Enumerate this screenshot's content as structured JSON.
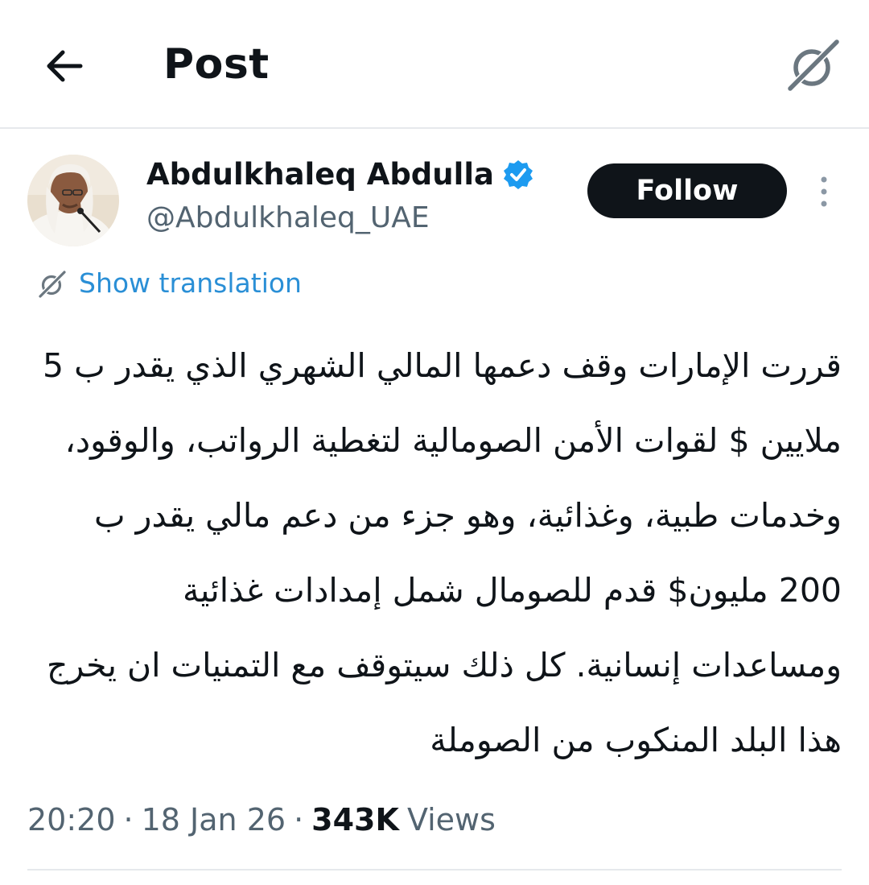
{
  "header": {
    "title": "Post",
    "back_icon": "arrow-left-icon",
    "grok_icon": "grok-icon"
  },
  "author": {
    "name": "Abdulkhaleq Abdulla",
    "handle": "@Abdulkhaleq_UAE",
    "verified": true,
    "follow_label": "Follow"
  },
  "translation": {
    "label": "Show translation"
  },
  "post": {
    "text": "قررت الإمارات وقف دعمها المالي الشهري الذي يقدر ب 5 ملايين $ لقوات الأمن الصومالية لتغطية الرواتب، والوقود، وخدمات طبية، وغذائية، وهو جزء من دعم مالي يقدر ب 200 مليون$ قدم للصومال شمل إمدادات غذائية ومساعدات إنسانية. كل ذلك سيتوقف مع التمنيات ان يخرج هذا البلد المنكوب من الصوملة"
  },
  "meta": {
    "time": "20:20",
    "date": "18 Jan 26",
    "views_count": "343K",
    "views_label": "Views",
    "separator": "·"
  },
  "colors": {
    "accent": "#1d9bf0",
    "text": "#0f1419",
    "secondary": "#536471",
    "divider": "#e6e9ec"
  }
}
